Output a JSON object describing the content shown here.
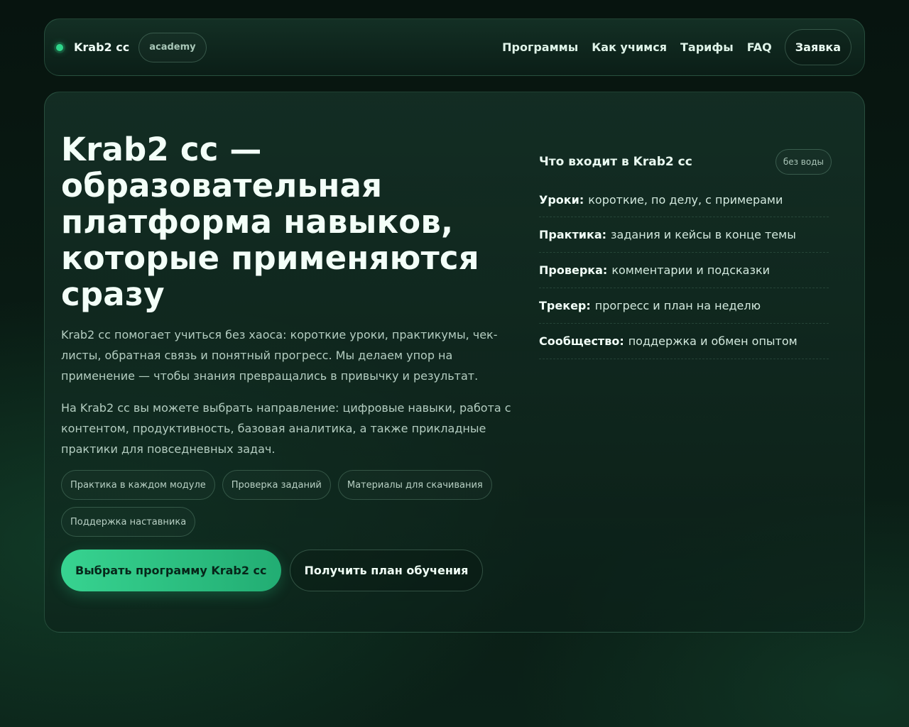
{
  "header": {
    "brand": "Krab2 cc",
    "badge": "academy",
    "nav": [
      "Программы",
      "Как учимся",
      "Тарифы",
      "FAQ"
    ],
    "cta": "Заявка"
  },
  "hero": {
    "title": "Krab2 cc — образовательная платформа навыков, которые применяются сразу",
    "p1": "Krab2 cc помогает учиться без хаоса: короткие уроки, практикумы, чек-листы, обратная связь и понятный прогресс. Мы делаем упор на применение — чтобы знания превращались в привычку и результат.",
    "p2": "На Krab2 cc вы можете выбрать направление: цифровые навыки, работа с контентом, продуктивность, базовая аналитика, а также прикладные практики для повседневных задач.",
    "chips": [
      "Практика в каждом модуле",
      "Проверка заданий",
      "Материалы для скачивания",
      "Поддержка наставника"
    ],
    "primary_button": "Выбрать программу Krab2 cc",
    "secondary_button": "Получить план обучения"
  },
  "side": {
    "title": "Что входит в Krab2 cc",
    "badge": "без воды",
    "items": [
      {
        "key": "Уроки:",
        "text": "короткие, по делу, с примерами"
      },
      {
        "key": "Практика:",
        "text": "задания и кейсы в конце темы"
      },
      {
        "key": "Проверка:",
        "text": "комментарии и подсказки"
      },
      {
        "key": "Трекер:",
        "text": "прогресс и план на неделю"
      },
      {
        "key": "Сообщество:",
        "text": "поддержка и обмен опытом"
      }
    ]
  },
  "colors": {
    "accent": "#2fd68b",
    "background": "#0a1d15",
    "button_gradient_start": "#37d390",
    "button_gradient_end": "#22ad73"
  }
}
